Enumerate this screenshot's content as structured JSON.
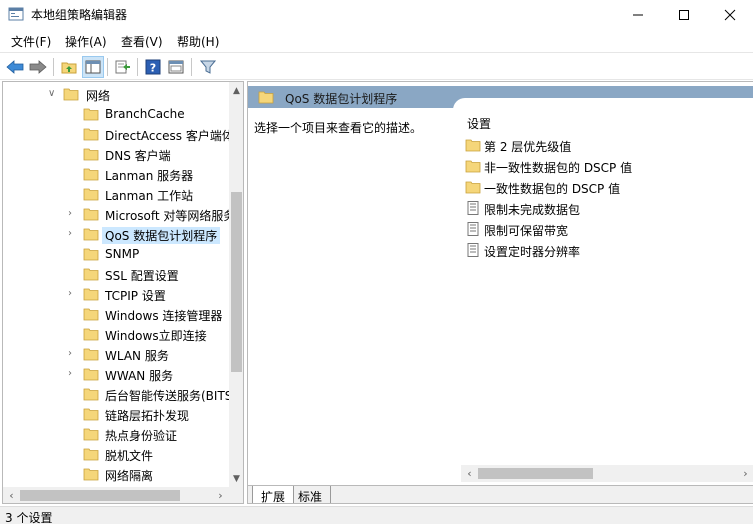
{
  "window": {
    "title": "本地组策略编辑器"
  },
  "menu": {
    "items": [
      "文件(F)",
      "操作(A)",
      "查看(V)",
      "帮助(H)"
    ]
  },
  "toolbar": {
    "buttons": [
      "back-arrow-icon",
      "forward-arrow-icon",
      "up-folder-icon",
      "show-hide-tree-icon",
      "export-list-icon",
      "help-icon",
      "properties-icon",
      "filter-icon"
    ]
  },
  "tree": {
    "items": [
      {
        "label": "网络",
        "expander": "v"
      },
      {
        "label": "BranchCache",
        "expander": ""
      },
      {
        "label": "DirectAccess 客户端体",
        "expander": ""
      },
      {
        "label": "DNS 客户端",
        "expander": ""
      },
      {
        "label": "Lanman 服务器",
        "expander": ""
      },
      {
        "label": "Lanman 工作站",
        "expander": ""
      },
      {
        "label": "Microsoft 对等网络服务",
        "expander": ">"
      },
      {
        "label": "QoS 数据包计划程序",
        "expander": ">"
      },
      {
        "label": "SNMP",
        "expander": ""
      },
      {
        "label": "SSL 配置设置",
        "expander": ""
      },
      {
        "label": "TCPIP 设置",
        "expander": ">"
      },
      {
        "label": "Windows 连接管理器",
        "expander": ""
      },
      {
        "label": "Windows立即连接",
        "expander": ""
      },
      {
        "label": "WLAN 服务",
        "expander": ">"
      },
      {
        "label": "WWAN 服务",
        "expander": ">"
      },
      {
        "label": "后台智能传送服务(BITS",
        "expander": ""
      },
      {
        "label": "链路层拓扑发现",
        "expander": ""
      },
      {
        "label": "热点身份验证",
        "expander": ""
      },
      {
        "label": "脱机文件",
        "expander": ""
      },
      {
        "label": "网络隔离",
        "expander": ""
      }
    ]
  },
  "right": {
    "header": "QoS 数据包计划程序",
    "description": "选择一个项目来查看它的描述。",
    "column": "设置",
    "items": [
      {
        "label": "第 2 层优先级值",
        "icon": "folder-icon"
      },
      {
        "label": "非一致性数据包的 DSCP 值",
        "icon": "folder-icon"
      },
      {
        "label": "一致性数据包的 DSCP 值",
        "icon": "folder-icon"
      },
      {
        "label": "限制未完成数据包",
        "icon": "policy-setting-icon"
      },
      {
        "label": "限制可保留带宽",
        "icon": "policy-setting-icon"
      },
      {
        "label": "设置定时器分辨率",
        "icon": "policy-setting-icon"
      }
    ]
  },
  "tabs": [
    "扩展",
    "标准"
  ],
  "status": {
    "text": "3 个设置"
  },
  "colors": {
    "header_bg": "#8aa7c4",
    "folder": "#f5d67a",
    "selection": "#cce8ff"
  }
}
